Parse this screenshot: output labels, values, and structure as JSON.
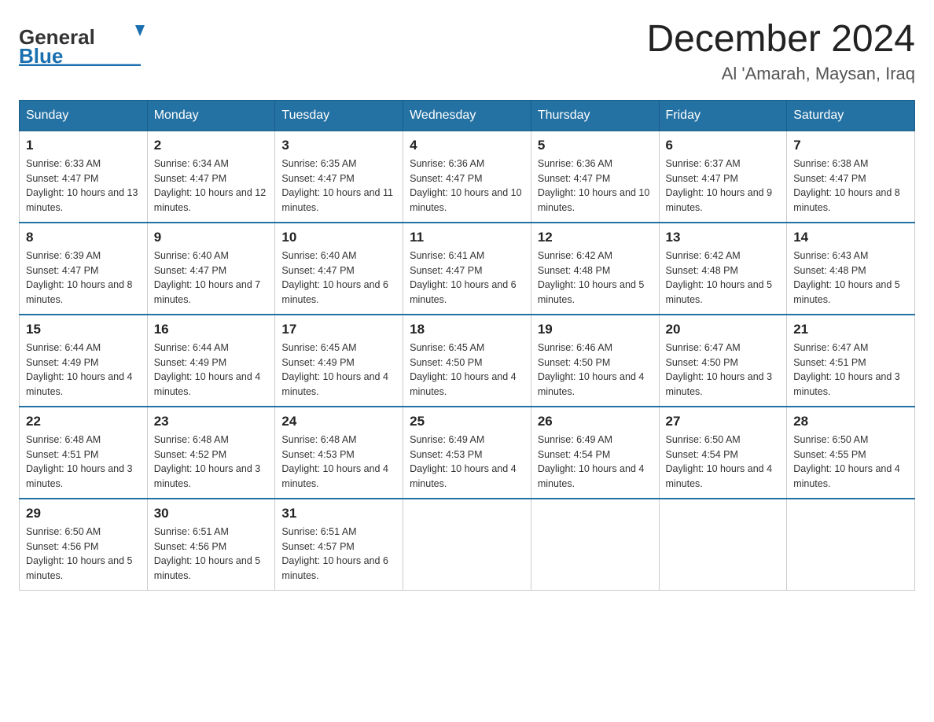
{
  "header": {
    "logo_general": "General",
    "logo_blue": "Blue",
    "month_title": "December 2024",
    "location": "Al 'Amarah, Maysan, Iraq"
  },
  "weekdays": [
    "Sunday",
    "Monday",
    "Tuesday",
    "Wednesday",
    "Thursday",
    "Friday",
    "Saturday"
  ],
  "weeks": [
    [
      {
        "day": "1",
        "sunrise": "6:33 AM",
        "sunset": "4:47 PM",
        "daylight": "10 hours and 13 minutes."
      },
      {
        "day": "2",
        "sunrise": "6:34 AM",
        "sunset": "4:47 PM",
        "daylight": "10 hours and 12 minutes."
      },
      {
        "day": "3",
        "sunrise": "6:35 AM",
        "sunset": "4:47 PM",
        "daylight": "10 hours and 11 minutes."
      },
      {
        "day": "4",
        "sunrise": "6:36 AM",
        "sunset": "4:47 PM",
        "daylight": "10 hours and 10 minutes."
      },
      {
        "day": "5",
        "sunrise": "6:36 AM",
        "sunset": "4:47 PM",
        "daylight": "10 hours and 10 minutes."
      },
      {
        "day": "6",
        "sunrise": "6:37 AM",
        "sunset": "4:47 PM",
        "daylight": "10 hours and 9 minutes."
      },
      {
        "day": "7",
        "sunrise": "6:38 AM",
        "sunset": "4:47 PM",
        "daylight": "10 hours and 8 minutes."
      }
    ],
    [
      {
        "day": "8",
        "sunrise": "6:39 AM",
        "sunset": "4:47 PM",
        "daylight": "10 hours and 8 minutes."
      },
      {
        "day": "9",
        "sunrise": "6:40 AM",
        "sunset": "4:47 PM",
        "daylight": "10 hours and 7 minutes."
      },
      {
        "day": "10",
        "sunrise": "6:40 AM",
        "sunset": "4:47 PM",
        "daylight": "10 hours and 6 minutes."
      },
      {
        "day": "11",
        "sunrise": "6:41 AM",
        "sunset": "4:47 PM",
        "daylight": "10 hours and 6 minutes."
      },
      {
        "day": "12",
        "sunrise": "6:42 AM",
        "sunset": "4:48 PM",
        "daylight": "10 hours and 5 minutes."
      },
      {
        "day": "13",
        "sunrise": "6:42 AM",
        "sunset": "4:48 PM",
        "daylight": "10 hours and 5 minutes."
      },
      {
        "day": "14",
        "sunrise": "6:43 AM",
        "sunset": "4:48 PM",
        "daylight": "10 hours and 5 minutes."
      }
    ],
    [
      {
        "day": "15",
        "sunrise": "6:44 AM",
        "sunset": "4:49 PM",
        "daylight": "10 hours and 4 minutes."
      },
      {
        "day": "16",
        "sunrise": "6:44 AM",
        "sunset": "4:49 PM",
        "daylight": "10 hours and 4 minutes."
      },
      {
        "day": "17",
        "sunrise": "6:45 AM",
        "sunset": "4:49 PM",
        "daylight": "10 hours and 4 minutes."
      },
      {
        "day": "18",
        "sunrise": "6:45 AM",
        "sunset": "4:50 PM",
        "daylight": "10 hours and 4 minutes."
      },
      {
        "day": "19",
        "sunrise": "6:46 AM",
        "sunset": "4:50 PM",
        "daylight": "10 hours and 4 minutes."
      },
      {
        "day": "20",
        "sunrise": "6:47 AM",
        "sunset": "4:50 PM",
        "daylight": "10 hours and 3 minutes."
      },
      {
        "day": "21",
        "sunrise": "6:47 AM",
        "sunset": "4:51 PM",
        "daylight": "10 hours and 3 minutes."
      }
    ],
    [
      {
        "day": "22",
        "sunrise": "6:48 AM",
        "sunset": "4:51 PM",
        "daylight": "10 hours and 3 minutes."
      },
      {
        "day": "23",
        "sunrise": "6:48 AM",
        "sunset": "4:52 PM",
        "daylight": "10 hours and 3 minutes."
      },
      {
        "day": "24",
        "sunrise": "6:48 AM",
        "sunset": "4:53 PM",
        "daylight": "10 hours and 4 minutes."
      },
      {
        "day": "25",
        "sunrise": "6:49 AM",
        "sunset": "4:53 PM",
        "daylight": "10 hours and 4 minutes."
      },
      {
        "day": "26",
        "sunrise": "6:49 AM",
        "sunset": "4:54 PM",
        "daylight": "10 hours and 4 minutes."
      },
      {
        "day": "27",
        "sunrise": "6:50 AM",
        "sunset": "4:54 PM",
        "daylight": "10 hours and 4 minutes."
      },
      {
        "day": "28",
        "sunrise": "6:50 AM",
        "sunset": "4:55 PM",
        "daylight": "10 hours and 4 minutes."
      }
    ],
    [
      {
        "day": "29",
        "sunrise": "6:50 AM",
        "sunset": "4:56 PM",
        "daylight": "10 hours and 5 minutes."
      },
      {
        "day": "30",
        "sunrise": "6:51 AM",
        "sunset": "4:56 PM",
        "daylight": "10 hours and 5 minutes."
      },
      {
        "day": "31",
        "sunrise": "6:51 AM",
        "sunset": "4:57 PM",
        "daylight": "10 hours and 6 minutes."
      },
      null,
      null,
      null,
      null
    ]
  ],
  "labels": {
    "sunrise": "Sunrise:",
    "sunset": "Sunset:",
    "daylight": "Daylight:"
  }
}
